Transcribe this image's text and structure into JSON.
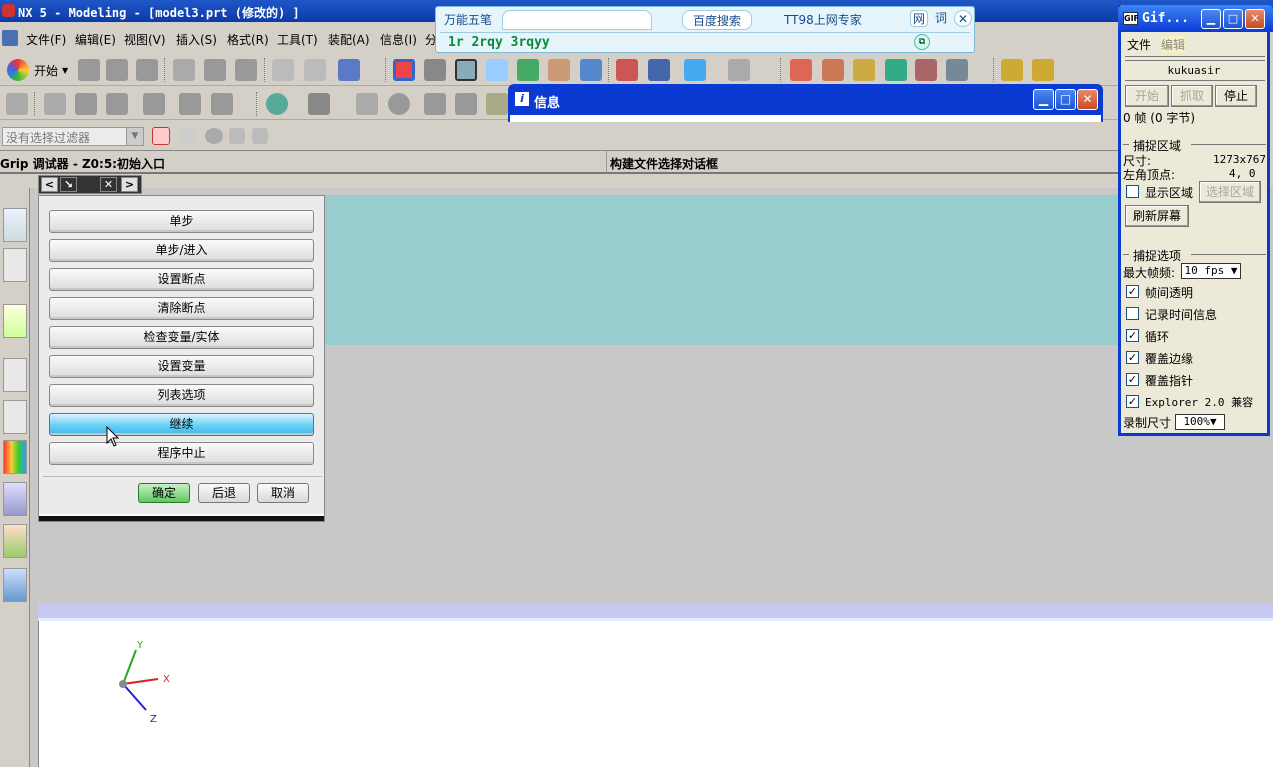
{
  "window": {
    "title": "NX 5 - Modeling - [model3.prt  (修改的) ]"
  },
  "menu": [
    "文件(F)",
    "编辑(E)",
    "视图(V)",
    "插入(S)",
    "格式(R)",
    "工具(T)",
    "装配(A)",
    "信息(I)",
    "分"
  ],
  "toolbar": {
    "start_label": "开始"
  },
  "filter": {
    "placeholder": "没有选择过滤器"
  },
  "status": {
    "left": "Grip 调试器 - Z0:5:初始入口",
    "center": "构建文件选择对话框"
  },
  "ime": {
    "tabs": [
      "万能五笔",
      "百度搜索",
      "TT98上网专家",
      "网",
      "词"
    ],
    "input": "1r 2rqy 3rqyy"
  },
  "info_window": {
    "title": "信息"
  },
  "debugger": {
    "buttons": [
      "单步",
      "单步/进入",
      "设置断点",
      "清除断点",
      "检查变量/实体",
      "设置变量",
      "列表选项",
      "继续",
      "程序中止"
    ],
    "active_index": 7,
    "ok": "确定",
    "back": "后退",
    "cancel": "取消"
  },
  "gif_window": {
    "title": "Gif...",
    "menu_file": "文件",
    "menu_edit": "编辑",
    "name": "kukuasir",
    "start": "开始",
    "capture": "抓取",
    "stop": "停止",
    "frames": "0 帧 (0 字节)",
    "capture_area": "捕捉区域",
    "size_label": "尺寸:",
    "size_value": "1273x767",
    "corner_label": "左角顶点:",
    "corner_value": "4, 0",
    "show_area": "显示区域",
    "select_area": "选择区域",
    "refresh": "刷新屏幕",
    "capture_options": "捕捉选项",
    "max_fps_label": "最大帧频:",
    "max_fps_value": "10 fps",
    "options": [
      {
        "label": "帧间透明",
        "checked": true
      },
      {
        "label": "记录时间信息",
        "checked": false
      },
      {
        "label": "循环",
        "checked": true
      },
      {
        "label": "覆盖边缘",
        "checked": true
      },
      {
        "label": "覆盖指针",
        "checked": true
      },
      {
        "label": "Explorer 2.0 兼容",
        "checked": true
      }
    ],
    "record_size_label": "录制尺寸",
    "record_size_value": "100%"
  },
  "axes": {
    "x": "X",
    "y": "Y",
    "z": "Z"
  }
}
